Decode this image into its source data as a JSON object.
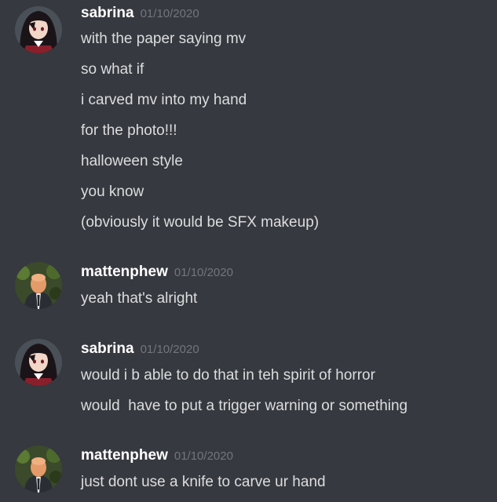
{
  "groups": [
    {
      "author": "sabrina",
      "timestamp": "01/10/2020",
      "avatar_icon": "anime-girl-avatar",
      "messages": [
        "with the paper saying mv",
        "so what if",
        "i carved mv into my hand",
        "for the photo!!!",
        "halloween style",
        "you know",
        "(obviously it would be SFX makeup)"
      ]
    },
    {
      "author": "mattenphew",
      "timestamp": "01/10/2020",
      "avatar_icon": "bald-man-suit-avatar",
      "messages": [
        "yeah that's alright"
      ]
    },
    {
      "author": "sabrina",
      "timestamp": "01/10/2020",
      "avatar_icon": "anime-girl-avatar",
      "messages": [
        "would i b able to do that in teh spirit of horror",
        "would  have to put a trigger warning or something"
      ]
    },
    {
      "author": "mattenphew",
      "timestamp": "01/10/2020",
      "avatar_icon": "bald-man-suit-avatar",
      "messages": [
        "just dont use a knife to carve ur hand"
      ]
    }
  ],
  "colors": {
    "background": "#36393f",
    "username": "#ffffff",
    "timestamp": "#72767d",
    "message_text": "#dcddde"
  }
}
